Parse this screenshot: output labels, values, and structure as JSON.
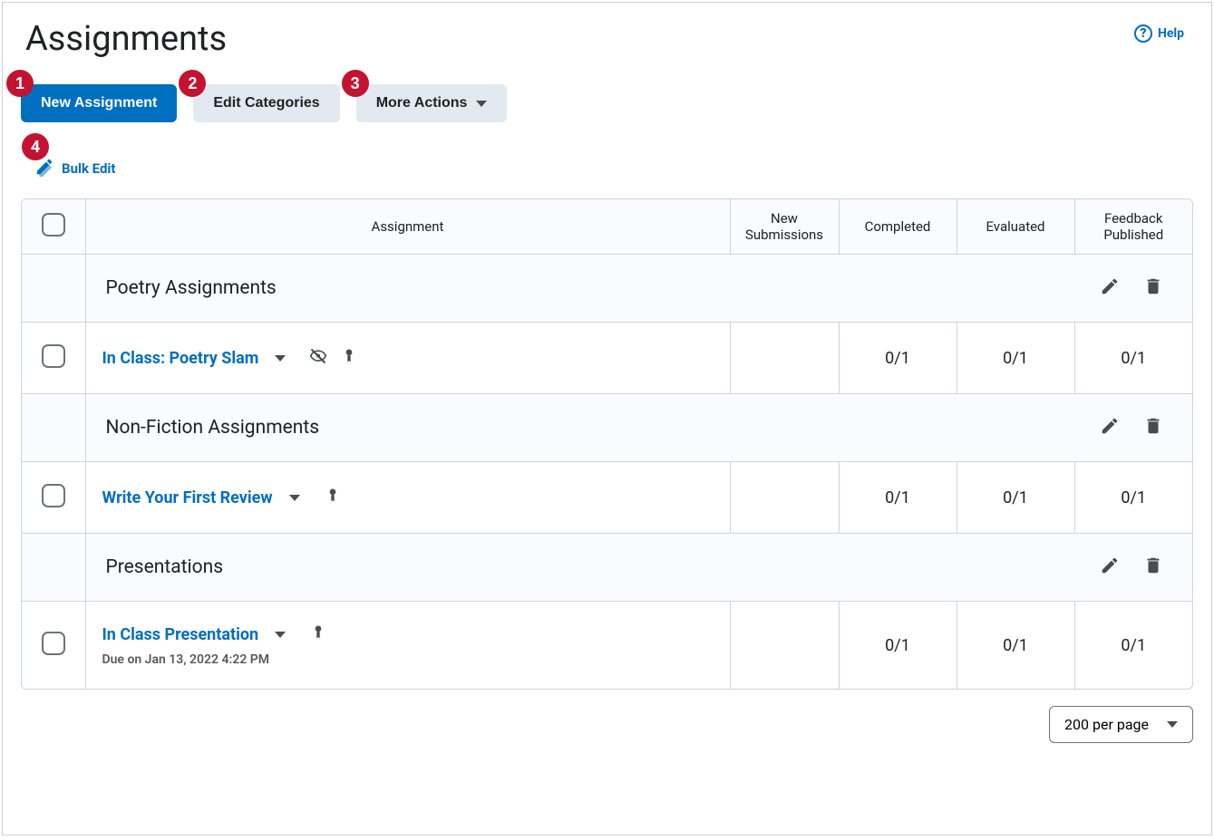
{
  "page": {
    "title": "Assignments",
    "help_label": "Help"
  },
  "toolbar": {
    "new_assignment_label": "New Assignment",
    "edit_categories_label": "Edit Categories",
    "more_actions_label": "More Actions",
    "bulk_edit_label": "Bulk Edit"
  },
  "callouts": {
    "b1": "1",
    "b2": "2",
    "b3": "3",
    "b4": "4"
  },
  "table": {
    "headers": {
      "assignment": "Assignment",
      "new_submissions": "New Submissions",
      "completed": "Completed",
      "evaluated": "Evaluated",
      "feedback_published": "Feedback Published"
    },
    "categories": [
      {
        "name": "Poetry Assignments",
        "assignments": [
          {
            "name": "In Class: Poetry Slam",
            "has_hidden_icon": true,
            "has_special_icon": true,
            "due": "",
            "new_submissions": "",
            "completed": "0/1",
            "evaluated": "0/1",
            "feedback": "0/1"
          }
        ]
      },
      {
        "name": "Non-Fiction Assignments",
        "assignments": [
          {
            "name": "Write Your First Review",
            "has_hidden_icon": false,
            "has_special_icon": true,
            "due": "",
            "new_submissions": "",
            "completed": "0/1",
            "evaluated": "0/1",
            "feedback": "0/1"
          }
        ]
      },
      {
        "name": "Presentations",
        "assignments": [
          {
            "name": "In Class Presentation",
            "has_hidden_icon": false,
            "has_special_icon": true,
            "due": "Due on Jan 13, 2022 4:22 PM",
            "new_submissions": "",
            "completed": "0/1",
            "evaluated": "0/1",
            "feedback": "0/1"
          }
        ]
      }
    ]
  },
  "pagination": {
    "per_page_label": "200 per page"
  }
}
